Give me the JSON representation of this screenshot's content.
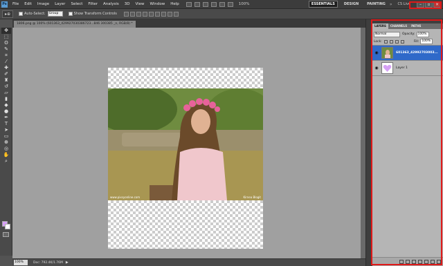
{
  "menubar": {
    "logo": "Ps",
    "items": [
      "File",
      "Edit",
      "Image",
      "Layer",
      "Select",
      "Filter",
      "Analysis",
      "3D",
      "View",
      "Window",
      "Help"
    ],
    "zoom": "100%",
    "workspaces": [
      "ESSENTIALS",
      "DESIGN",
      "PAINTING"
    ],
    "more_workspaces": "»",
    "cs_live": "CS Live"
  },
  "options": {
    "tool_icon": "▸⊕",
    "auto_select_label": "Auto-Select:",
    "auto_select_value": "Group",
    "show_transform_label": "Show Transform Controls"
  },
  "document": {
    "tab_title": "1806.png @ 100% (601363_429927030386723...846 300385 _n, RGB/8) *",
    "credit": "www.pixsyonline.com",
    "signature": "Kirnea Blogit"
  },
  "statusbar": {
    "zoom": "100%",
    "doc_info": "Doc: 792.4K/1.76M",
    "arrow": "▶"
  },
  "layers_panel": {
    "tabs": [
      "LAYERS",
      "CHANNELS",
      "PATHS"
    ],
    "blend_mode": "Normal",
    "opacity_label": "Opacity:",
    "opacity_value": "100%",
    "lock_label": "Lock:",
    "fill_label": "Fill:",
    "fill_value": "100%",
    "layers": [
      {
        "name": "601363_42992703003...",
        "selected": true
      },
      {
        "name": "Layer 1",
        "selected": false
      }
    ]
  },
  "colors": {
    "foreground": "#d6a0f5",
    "background": "#ffffff",
    "selection": "#2f69c9",
    "highlight": "#e01818"
  }
}
